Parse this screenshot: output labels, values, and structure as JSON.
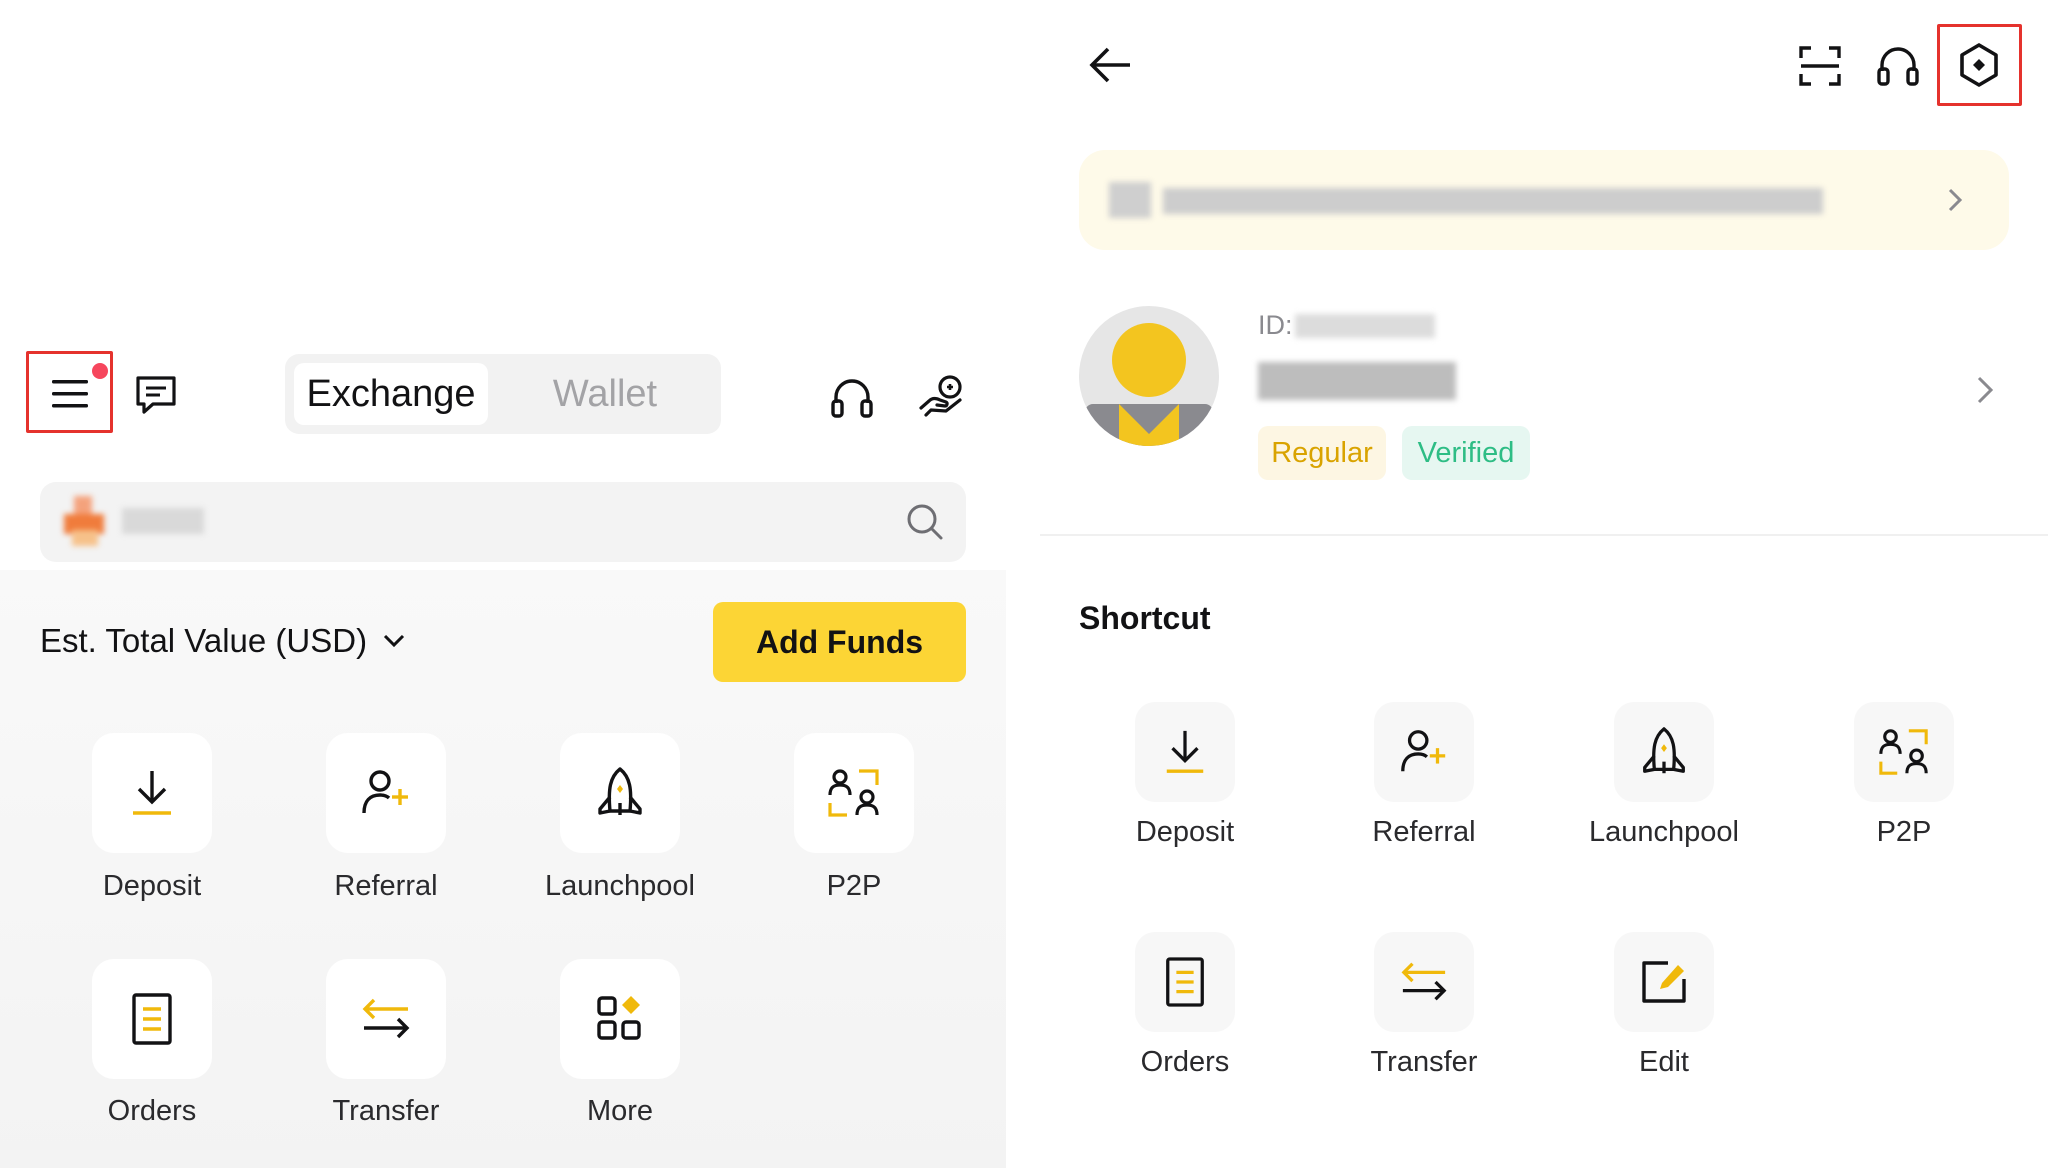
{
  "left": {
    "tabs": [
      {
        "label": "Exchange",
        "active": true
      },
      {
        "label": "Wallet",
        "active": false
      }
    ],
    "est_total_label": "Est. Total Value (USD)",
    "add_funds_label": "Add Funds",
    "shortcuts": [
      {
        "label": "Deposit",
        "icon": "deposit-icon"
      },
      {
        "label": "Referral",
        "icon": "referral-icon"
      },
      {
        "label": "Launchpool",
        "icon": "launchpool-icon"
      },
      {
        "label": "P2P",
        "icon": "p2p-icon"
      },
      {
        "label": "Orders",
        "icon": "orders-icon"
      },
      {
        "label": "Transfer",
        "icon": "transfer-icon"
      },
      {
        "label": "More",
        "icon": "more-icon"
      }
    ]
  },
  "right": {
    "id_prefix": "ID:",
    "badges": {
      "regular": "Regular",
      "verified": "Verified"
    },
    "shortcut_title": "Shortcut",
    "shortcuts": [
      {
        "label": "Deposit",
        "icon": "deposit-icon"
      },
      {
        "label": "Referral",
        "icon": "referral-icon"
      },
      {
        "label": "Launchpool",
        "icon": "launchpool-icon"
      },
      {
        "label": "P2P",
        "icon": "p2p-icon"
      },
      {
        "label": "Orders",
        "icon": "orders-icon"
      },
      {
        "label": "Transfer",
        "icon": "transfer-icon"
      },
      {
        "label": "Edit",
        "icon": "edit-icon"
      }
    ]
  },
  "colors": {
    "accent_yellow": "#fcd535",
    "icon_yellow": "#f0b90b",
    "highlight_red": "#e5322d",
    "verified_green": "#2ebd85",
    "notification_red": "#f6465d"
  }
}
